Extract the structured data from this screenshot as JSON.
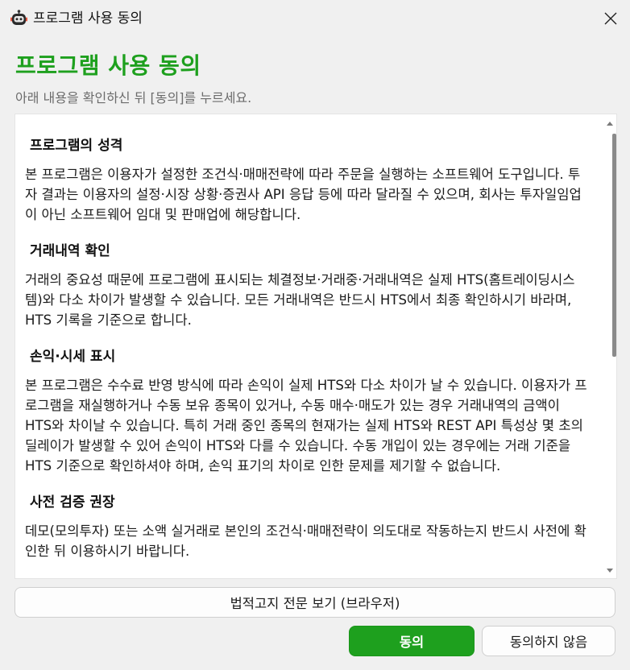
{
  "window": {
    "title": "프로그램 사용 동의",
    "close_label": "닫기"
  },
  "header": {
    "title": "프로그램 사용 동의",
    "subtitle": "아래 내용을 확인하신 뒤 [동의]를 누르세요."
  },
  "sections": [
    {
      "title": "프로그램의 성격",
      "body": "본 프로그램은 이용자가 설정한 조건식·매매전략에 따라 주문을 실행하는 소프트웨어 도구입니다. 투자 결과는 이용자의 설정·시장 상황·증권사 API 응답 등에 따라 달라질 수 있으며, 회사는 투자일임업이 아닌 소프트웨어 임대 및 판매업에 해당합니다."
    },
    {
      "title": "거래내역 확인",
      "body": "거래의 중요성 때문에 프로그램에 표시되는 체결정보·거래중·거래내역은 실제 HTS(홈트레이딩시스템)와 다소 차이가 발생할 수 있습니다. 모든 거래내역은 반드시 HTS에서 최종 확인하시기 바라며, HTS 기록을 기준으로 합니다."
    },
    {
      "title": "손익·시세 표시",
      "body": "본 프로그램은 수수료 반영 방식에 따라 손익이 실제 HTS와 다소 차이가 날 수 있습니다. 이용자가 프로그램을 재실행하거나 수동 보유 종목이 있거나, 수동 매수·매도가 있는 경우 거래내역의 금액이 HTS와 차이날 수 있습니다. 특히 거래 중인 종목의 현재가는 실제 HTS와 REST API 특성상 몇 초의 딜레이가 발생할 수 있어 손익이 HTS와 다를 수 있습니다. 수동 개입이 있는 경우에는 거래 기준을 HTS 기준으로 확인하셔야 하며, 손익 표기의 차이로 인한 문제를 제기할 수 없습니다."
    },
    {
      "title": "사전 검증 권장",
      "body": "데모(모의투자) 또는 소액 실거래로 본인의 조건식·매매전략이 의도대로 작동하는지 반드시 사전에 확인한 뒤 이용하시기 바랍니다."
    }
  ],
  "buttons": {
    "full_text": "법적고지 전문 보기 (브라우저)",
    "agree": "동의",
    "decline": "동의하지 않음"
  },
  "colors": {
    "accent": "#1ea01e",
    "background": "#f0f0f0",
    "content_bg": "#ffffff"
  },
  "icons": {
    "app": "robot-icon",
    "close": "close-icon",
    "scroll_up": "scroll-up-arrow-icon",
    "scroll_down": "scroll-down-arrow-icon"
  }
}
